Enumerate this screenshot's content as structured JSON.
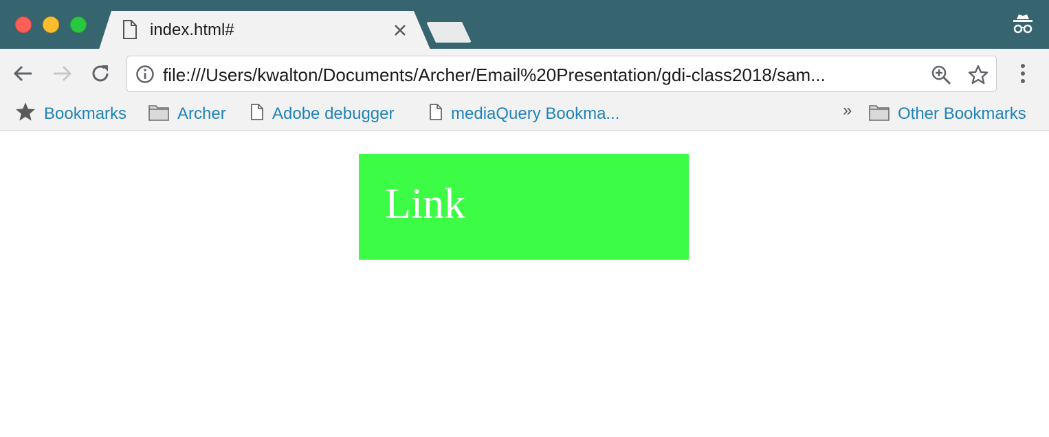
{
  "tab": {
    "title": "index.html#"
  },
  "toolbar": {
    "url": "file:///Users/kwalton/Documents/Archer/Email%20Presentation/gdi-class2018/sam..."
  },
  "bookmarks": {
    "items": [
      {
        "label": "Bookmarks",
        "icon": "star-icon"
      },
      {
        "label": "Archer",
        "icon": "folder-icon"
      },
      {
        "label": "Adobe debugger",
        "icon": "page-icon"
      },
      {
        "label": "mediaQuery Bookma...",
        "icon": "page-icon"
      }
    ],
    "overflow": "»",
    "other": {
      "label": "Other Bookmarks",
      "icon": "folder-icon"
    }
  },
  "page": {
    "link_label": "Link"
  },
  "colors": {
    "titlebar": "#36646f",
    "link_background": "#3dfc46",
    "bookmark_text": "#1f83b9"
  }
}
